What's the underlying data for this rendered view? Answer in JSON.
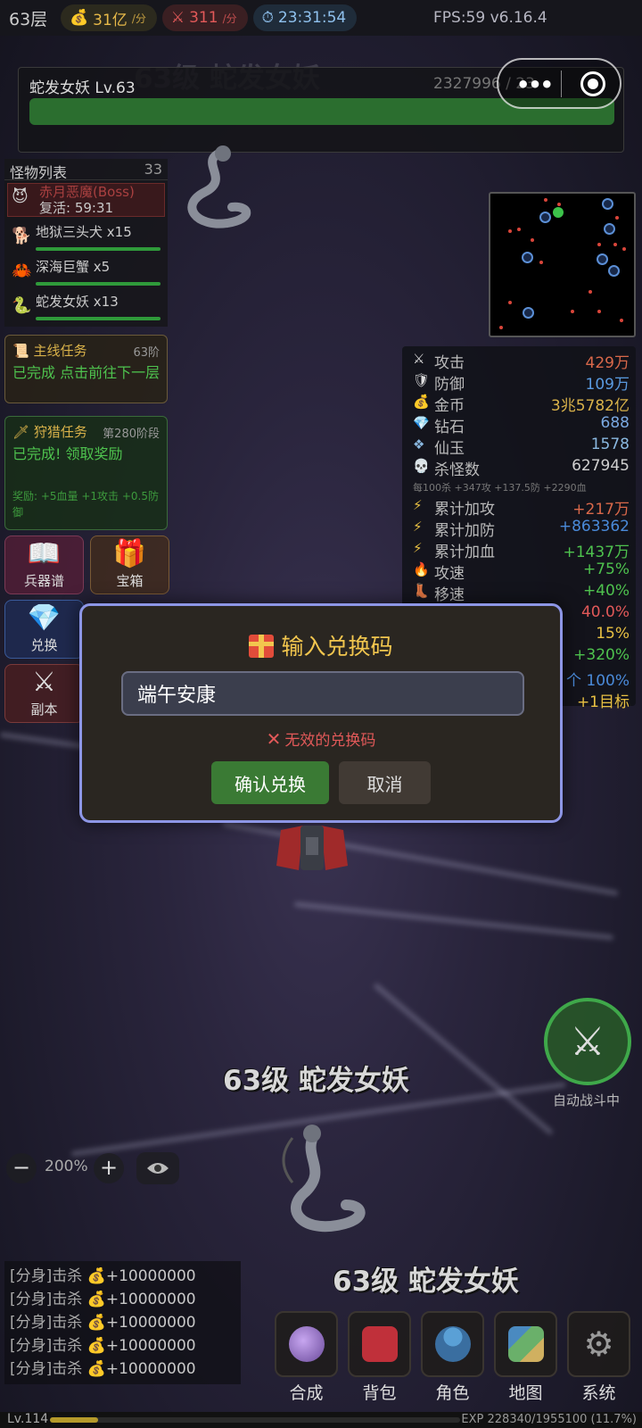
{
  "topbar": {
    "floor": "63层",
    "gold_rate": "31亿",
    "gold_unit": "/分",
    "kill_rate": "311",
    "kill_unit": "/分",
    "timer": "23:31:54",
    "fps": "FPS:59 v6.16.4"
  },
  "boss": {
    "name": "蛇发女妖 Lv.63",
    "hp_text": "2327996 / 23",
    "hp_fraction": 1.0,
    "ghost_title": "63级 蛇发女妖"
  },
  "monster_list": {
    "title": "怪物列表",
    "count": "33",
    "boss_name": "赤月恶魔(Boss)",
    "boss_respawn": "复活: 59:31",
    "items": [
      {
        "name": "地狱三头犬 x15",
        "icon": "dog-icon"
      },
      {
        "name": "深海巨蟹 x5",
        "icon": "crab-icon"
      },
      {
        "name": "蛇发女妖 x13",
        "icon": "snake-icon"
      }
    ]
  },
  "main_quest": {
    "title": "主线任务",
    "stage": "63阶",
    "body": "已完成 点击前往下一层"
  },
  "hunt_quest": {
    "title": "狩猎任务",
    "stage": "第280阶段",
    "body": "已完成! 领取奖励",
    "reward": "奖励: +5血量 +1攻击 +0.5防御"
  },
  "tiles": {
    "weapon": "兵器谱",
    "chest": "宝箱",
    "exchange": "兑换",
    "dungeon": "副本"
  },
  "stats": {
    "attack_label": "攻击",
    "attack_value": "429万",
    "defense_label": "防御",
    "defense_value": "109万",
    "gold_label": "金币",
    "gold_value": "3兆5782亿",
    "diamond_label": "钻石",
    "diamond_value": "688",
    "jade_label": "仙玉",
    "jade_value": "1578",
    "kills_label": "杀怪数",
    "kills_value": "627945",
    "per_note": "每100杀 +347攻 +137.5防 +2290血",
    "acc_atk_label": "累计加攻",
    "acc_atk_value": "+217万",
    "acc_def_label": "累计加防",
    "acc_def_value": "+863362",
    "acc_hp_label": "累计加血",
    "acc_hp_value": "+1437万",
    "aspd_label": "攻速",
    "aspd_value": "+75%",
    "mspd_label": "移速",
    "mspd_value": "+40%",
    "row3_value": "40.0%",
    "row4_value": "15%",
    "row5_value": "+320%",
    "row6_value": "个 100%",
    "row7_value": "+1目标"
  },
  "dialog": {
    "title": "输入兑换码",
    "input_value": "端午安康",
    "error": "无效的兑换码",
    "confirm": "确认兑换",
    "cancel": "取消"
  },
  "world": {
    "label1": "63级 蛇发女妖",
    "label2": "63级 蛇发女妖",
    "auto_battle": "自动战斗中"
  },
  "zoom": {
    "minus": "−",
    "plus": "+",
    "value": "200%"
  },
  "log": [
    {
      "prefix": "[分身]击杀",
      "amount": "+10000000"
    },
    {
      "prefix": "[分身]击杀",
      "amount": "+10000000"
    },
    {
      "prefix": "[分身]击杀",
      "amount": "+10000000"
    },
    {
      "prefix": "[分身]击杀",
      "amount": "+10000000"
    },
    {
      "prefix": "[分身]击杀",
      "amount": "+10000000"
    }
  ],
  "bottom_menu": [
    "合成",
    "背包",
    "角色",
    "地图",
    "系统"
  ],
  "exp": {
    "level": "Lv.114",
    "text": "EXP 228340/1955100 (11.7%)",
    "fraction": 0.117
  },
  "colors": {
    "gold": "#e7b949",
    "hp_green": "#2b6e2f",
    "dialog_border": "#8d96e6",
    "confirm_green": "#3a7a34"
  }
}
